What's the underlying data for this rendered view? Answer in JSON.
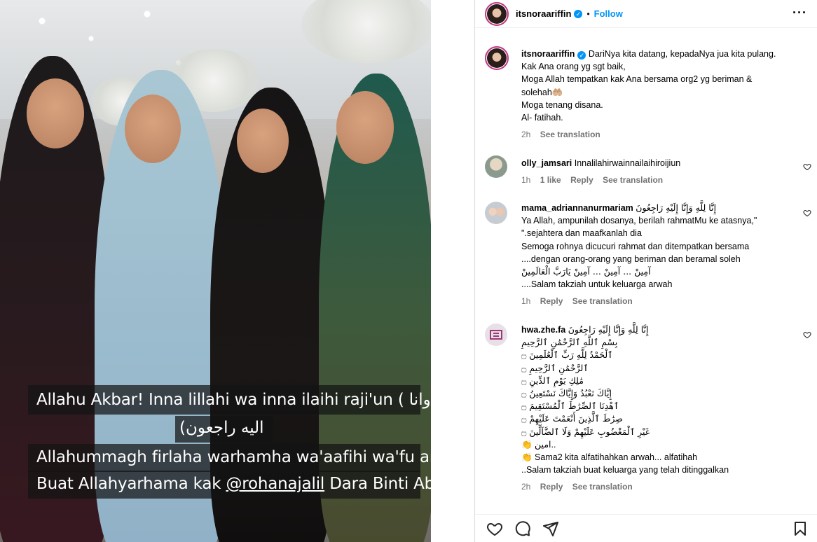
{
  "post": {
    "username": "itsnoraariffin",
    "follow_label": "Follow",
    "more_label": "···",
    "media": {
      "caption_lines": [
        "Allahu Akbar! Inna lillahi wa inna ilaihi raji'un ( انا لله وانا",
        "(اليه راجعون",
        "Allahummagh firlaha warhamha wa'aafihi wa'fu anha...",
        "Buat Allahyarhama kak ",
        "@rohanajalil",
        " Dara Binti Abd Jalil"
      ]
    },
    "caption": {
      "author": "itsnoraariffin",
      "lines": [
        "DariNya kita datang, kepadaNya jua kita pulang.",
        "Kak Ana orang yg sgt baik,",
        "Moga Allah tempatkan kak Ana bersama org2 yg beriman &",
        "solehah🤲🏼",
        "Moga tenang disana.",
        "Al- fatihah."
      ],
      "time": "2h",
      "translate": "See translation"
    },
    "comments": [
      {
        "username": "olly_jamsari",
        "text": "Innalilahirwainnailaihiroijiun",
        "time": "1h",
        "likes": "1 like",
        "reply": "Reply",
        "translate": "See translation"
      },
      {
        "username": "mama_adriannanurmariam",
        "lines": [
          "إِنَّا لِلَّهِ وَإِنَّا إِلَيْهِ رَاجِعُونَ",
          "Ya Allah, ampunilah dosanya, berilah rahmatMu ke atasnya,\"",
          "\".sejahtera dan maafkanlah dia",
          "Semoga rohnya dicucuri rahmat dan ditempatkan bersama",
          "....dengan orang-orang yang beriman dan beramal soleh",
          "آمِينْ ... آمِينْ ... آمِينْ يَارَبَّ الْعَالَمِينْ",
          "....Salam takziah untuk keluarga arwah"
        ],
        "time": "1h",
        "reply": "Reply",
        "translate": "See translation"
      },
      {
        "username": "hwa.zhe.fa",
        "lines": [
          "إِنَّا لِلَّهِ وَإِنَّا إِلَيْهِ رَاجِعُونَ",
          "بِسْمِ ٱللَّهِ ٱلرَّحْمَٰنِ ٱلرَّحِيمِ",
          "ٱلْحَمْدُ لِلَّهِ رَبِّ ٱلْعَٰلَمِينَ ۝",
          "ٱلرَّحْمَٰنِ ٱلرَّحِيمِ ۝",
          "مَٰلِكِ يَوْمِ ٱلدِّينِ ۝",
          "إِيَّاكَ نَعْبُدُ وَإِيَّاكَ نَسْتَعِينُ ۝",
          "ٱهْدِنَا ٱلصِّرَٰطَ ٱلْمُسْتَقِيمَ ۝",
          "صِرَٰطَ ٱلَّذِينَ أَنْعَمْتَ عَلَيْهِمْ ۝",
          "غَيْرِ ٱلْمَغْضُوبِ عَلَيْهِمْ وَلَا ٱلضَّآلِّينَ ۝",
          "👏 امين..",
          "👏 Sama2 kita alfatihahkan arwah... alfatihah",
          "..Salam takziah buat keluarga yang telah ditinggalkan"
        ],
        "time": "2h",
        "reply": "Reply",
        "translate": "See translation"
      }
    ]
  }
}
